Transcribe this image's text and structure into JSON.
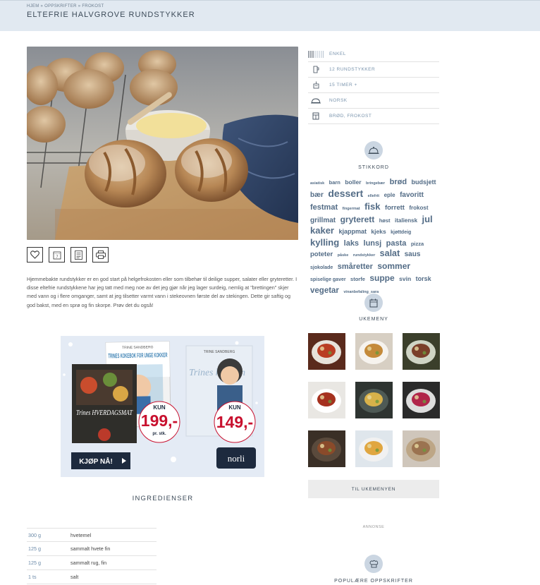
{
  "breadcrumb": {
    "items": [
      "HJEM",
      "OPPSKRIFTER",
      "FROKOST"
    ],
    "sep": " » "
  },
  "title": "ELTEFRIE HALVGROVE RUNDSTYKKER",
  "intro": "Hjemmebakte rundstykker er en god start på helgefrokosten eller som tilbehør til deilige supper, salater eller gryteretter. I disse eltefrie rundstykkene har jeg tatt med meg noe av det jeg gjør når jeg lager surdeig, nemlig at \"brettingen\" skjer med vann og i flere omganger, samt at jeg tilsetter varmt vann i stekeovnen første del av stekingen. Dette gir saftig og god bakst, med en sprø og fin skorpe. Prøv det du også!",
  "actions": {
    "calendar_number": "7"
  },
  "meta": [
    {
      "icon": "difficulty-icon",
      "label": "ENKEL"
    },
    {
      "icon": "servings-icon",
      "label": "12 RUNDSTYKKER"
    },
    {
      "icon": "timer-icon",
      "label": "15 TIMER +"
    },
    {
      "icon": "cloche-icon",
      "label": "NORSK"
    },
    {
      "icon": "category-icon",
      "label": "BRØD, FROKOST"
    }
  ],
  "stikkord": {
    "heading": "STIKKORD",
    "tags": [
      {
        "t": "asiatisk",
        "s": 5.5
      },
      {
        "t": "barn",
        "s": 7.5
      },
      {
        "t": "boller",
        "s": 8.5
      },
      {
        "t": "bringebær",
        "s": 5.5
      },
      {
        "t": "brød",
        "s": 11
      },
      {
        "t": "budsjett",
        "s": 9
      },
      {
        "t": "bær",
        "s": 10
      },
      {
        "t": "dessert",
        "s": 14
      },
      {
        "t": "ellefrit",
        "s": 5.5
      },
      {
        "t": "eple",
        "s": 8
      },
      {
        "t": "favoritt",
        "s": 10
      },
      {
        "t": "festmat",
        "s": 11
      },
      {
        "t": "fingermat",
        "s": 5.5
      },
      {
        "t": "fisk",
        "s": 13
      },
      {
        "t": "forrett",
        "s": 9.5
      },
      {
        "t": "frokost",
        "s": 8
      },
      {
        "t": "grillmat",
        "s": 10
      },
      {
        "t": "gryterett",
        "s": 12
      },
      {
        "t": "høst",
        "s": 7.5
      },
      {
        "t": "italiensk",
        "s": 8
      },
      {
        "t": "jul",
        "s": 13
      },
      {
        "t": "kaker",
        "s": 13
      },
      {
        "t": "kjappmat",
        "s": 9
      },
      {
        "t": "kjeks",
        "s": 8.5
      },
      {
        "t": "kjøttdeig",
        "s": 7
      },
      {
        "t": "kylling",
        "s": 13
      },
      {
        "t": "laks",
        "s": 11
      },
      {
        "t": "lunsj",
        "s": 11
      },
      {
        "t": "pasta",
        "s": 11
      },
      {
        "t": "pizza",
        "s": 7.5
      },
      {
        "t": "poteter",
        "s": 9.5
      },
      {
        "t": "påske",
        "s": 5.5
      },
      {
        "t": "rundstykker",
        "s": 5.5
      },
      {
        "t": "salat",
        "s": 12.5
      },
      {
        "t": "saus",
        "s": 10
      },
      {
        "t": "sjokolade",
        "s": 7
      },
      {
        "t": "småretter",
        "s": 11
      },
      {
        "t": "sommer",
        "s": 12
      },
      {
        "t": "spiselige gaver",
        "s": 7
      },
      {
        "t": "storfe",
        "s": 7.5
      },
      {
        "t": "suppe",
        "s": 12
      },
      {
        "t": "svin",
        "s": 8.5
      },
      {
        "t": "torsk",
        "s": 9
      },
      {
        "t": "vegetar",
        "s": 11.5
      },
      {
        "t": "vinanbefaling_sara",
        "s": 5.5
      }
    ]
  },
  "ukemeny": {
    "heading": "UKEMENY",
    "button": "TIL UKEMENYEN",
    "thumbs": [
      {
        "bg": "#5a2a1c",
        "plate": "#e7e2da",
        "food": "#b93d23"
      },
      {
        "bg": "#d7cfc3",
        "plate": "#f6f3ee",
        "food": "#c48a3a"
      },
      {
        "bg": "#3b3f2b",
        "plate": "#cfd4c4",
        "food": "#7a3f2a"
      },
      {
        "bg": "#e9e7e3",
        "plate": "#ffffff",
        "food": "#a5311f"
      },
      {
        "bg": "#2e3431",
        "plate": "#4e5a55",
        "food": "#d8b24a"
      },
      {
        "bg": "#2a2a2a",
        "plate": "#ddd",
        "food": "#b0254a"
      },
      {
        "bg": "#3a2f26",
        "plate": "#5a4a3c",
        "food": "#8a4a2a"
      },
      {
        "bg": "#dfe6ec",
        "plate": "#f1f1f1",
        "food": "#e0a640"
      },
      {
        "bg": "#cfc6bb",
        "plate": "#bda686",
        "food": "#9b7350"
      }
    ]
  },
  "annonse": "ANNONSE",
  "populaere": {
    "heading": "POPULÆRE OPPSKRIFTER"
  },
  "ad": {
    "author_top": "TRINE SANDBERG",
    "book1_title": "TRINES KOKEBOK FOR UNGE KOKKER",
    "book2_title": "Trines HVERDAGSMAT",
    "book3_title": "Trines kjøkken",
    "price1_kun": "KUN",
    "price1": "199,-",
    "price1_unit": "pr. stk.",
    "price2_kun": "KUN",
    "price2": "149,-",
    "cta": "KJØP NÅ!",
    "brand": "norli"
  },
  "ingredients": {
    "heading": "INGREDIENSER",
    "items": [
      {
        "qty": "300 g",
        "name": "hvetemel"
      },
      {
        "qty": "125 g",
        "name": "sammalt hvete fin"
      },
      {
        "qty": "125 g",
        "name": "sammalt rug, fin"
      },
      {
        "qty": "1 ts",
        "name": "salt"
      }
    ]
  },
  "colors": {
    "topbar": "#e1e9f1",
    "accent": "#536c86",
    "icon_circle": "#cbd6e2",
    "ad_bg": "#e4ebf5",
    "ad_red": "#c8102e",
    "ad_navy": "#1d2a3e"
  }
}
